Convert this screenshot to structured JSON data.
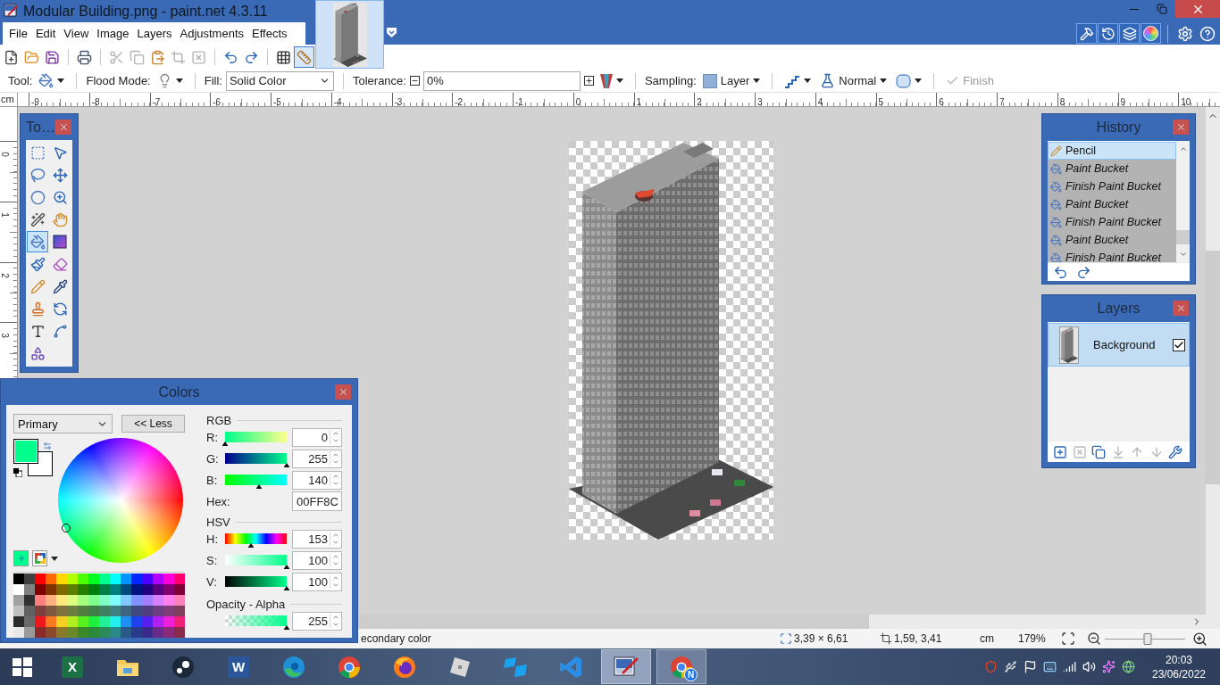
{
  "window": {
    "title": "Modular Building.png - paint.net 4.3.11",
    "menu": [
      "File",
      "Edit",
      "View",
      "Image",
      "Layers",
      "Adjustments",
      "Effects"
    ],
    "panel_toggles": [
      {
        "kind": "tools",
        "on": true
      },
      {
        "kind": "history",
        "on": true
      },
      {
        "kind": "layers",
        "on": true
      },
      {
        "kind": "colors",
        "on": true
      }
    ],
    "utility_buttons": [
      {
        "kind": "settings"
      },
      {
        "kind": "help"
      }
    ]
  },
  "toolbar": {
    "groups": [
      {
        "buttons": [
          {
            "kind": "new",
            "disabled": false,
            "on": false
          },
          {
            "kind": "open",
            "disabled": false,
            "on": false
          },
          {
            "kind": "save",
            "disabled": false,
            "on": false
          }
        ]
      },
      {
        "buttons": [
          {
            "kind": "print",
            "disabled": false,
            "on": false
          }
        ]
      },
      {
        "buttons": [
          {
            "kind": "cut",
            "disabled": true,
            "on": false
          },
          {
            "kind": "copy",
            "disabled": true,
            "on": false
          },
          {
            "kind": "paste",
            "disabled": false,
            "on": false
          },
          {
            "kind": "crop",
            "disabled": true,
            "on": false
          },
          {
            "kind": "deselect",
            "disabled": true,
            "on": false
          }
        ]
      },
      {
        "buttons": [
          {
            "kind": "undo",
            "disabled": false,
            "on": false
          },
          {
            "kind": "redo",
            "disabled": false,
            "on": false
          }
        ]
      },
      {
        "buttons": [
          {
            "kind": "grid",
            "disabled": false,
            "on": false
          },
          {
            "kind": "rulers",
            "disabled": false,
            "on": true
          }
        ]
      }
    ]
  },
  "options_bar": {
    "tool_label": "Tool:",
    "flood_mode_label": "Flood Mode:",
    "fill_label": "Fill:",
    "fill_value": "Solid Color",
    "tolerance_label": "Tolerance:",
    "tolerance_value": "0%",
    "sampling_label": "Sampling:",
    "sampling_value": "Layer",
    "blend_value": "Normal",
    "finish": {
      "label": "Finish",
      "disabled": true
    }
  },
  "ruler": {
    "unit": "cm",
    "horizontal": [
      "-9",
      "-8",
      "-7",
      "-6",
      "-5",
      "-4",
      "-3",
      "-2",
      "-1",
      "0",
      "1",
      "2",
      "3",
      "4",
      "5",
      "6",
      "7",
      "8",
      "9",
      "10"
    ],
    "vertical": [
      "0",
      "1",
      "2",
      "3"
    ]
  },
  "tools_window": {
    "title": "To…",
    "tools": [
      {
        "kind": "rect-select",
        "selected": false
      },
      {
        "kind": "move-pixels",
        "selected": false
      },
      {
        "kind": "lasso",
        "selected": false
      },
      {
        "kind": "move-selection",
        "selected": false
      },
      {
        "kind": "ellipse-select",
        "selected": false
      },
      {
        "kind": "zoom",
        "selected": false
      },
      {
        "kind": "magic-wand",
        "selected": false
      },
      {
        "kind": "pan",
        "selected": false
      },
      {
        "kind": "paint-bucket",
        "selected": true
      },
      {
        "kind": "gradient",
        "selected": false
      },
      {
        "kind": "paintbrush",
        "selected": false
      },
      {
        "kind": "eraser",
        "selected": false
      },
      {
        "kind": "pencil",
        "selected": false
      },
      {
        "kind": "color-picker",
        "selected": false
      },
      {
        "kind": "clone-stamp",
        "selected": false
      },
      {
        "kind": "recolor",
        "selected": false
      },
      {
        "kind": "text",
        "selected": false
      },
      {
        "kind": "line",
        "selected": false
      },
      {
        "kind": "shapes",
        "selected": false
      }
    ]
  },
  "colors_window": {
    "title": "Colors",
    "target": "Primary",
    "less_button": "<< Less",
    "swatches": [
      {
        "kind": "primary",
        "color": "#00ff8c"
      },
      {
        "kind": "secondary",
        "color": "#ffffff"
      }
    ],
    "rgb_heading": "RGB",
    "channels": [
      {
        "kind": "red",
        "label": "R:",
        "value": "0",
        "level": 0
      },
      {
        "kind": "green",
        "label": "G:",
        "value": "255",
        "level": 1
      },
      {
        "kind": "blue",
        "label": "B:",
        "value": "140",
        "level": 0.55
      }
    ],
    "hex_label": "Hex:",
    "hex_value": "00FF8C",
    "hsv_heading": "HSV",
    "hsv": [
      {
        "kind": "hue",
        "label": "H:",
        "value": "153",
        "level": 0.425
      },
      {
        "kind": "saturation",
        "label": "S:",
        "value": "100",
        "level": 1
      },
      {
        "kind": "value",
        "label": "V:",
        "value": "100",
        "level": 1
      }
    ],
    "alpha_heading": "Opacity - Alpha",
    "alpha": {
      "value": "255",
      "level": 1
    },
    "palette": [
      {
        "swatches": [
          {
            "color": "#000000"
          },
          {
            "color": "#404040"
          },
          {
            "color": "#ff0000"
          },
          {
            "color": "#ff6a00"
          },
          {
            "color": "#ffd800"
          },
          {
            "color": "#b6ff00"
          },
          {
            "color": "#4cff00"
          },
          {
            "color": "#00ff21"
          },
          {
            "color": "#00ff90"
          },
          {
            "color": "#00ffff"
          },
          {
            "color": "#0094ff"
          },
          {
            "color": "#0026ff"
          },
          {
            "color": "#4800ff"
          },
          {
            "color": "#b200ff"
          },
          {
            "color": "#ff00dc"
          },
          {
            "color": "#ff006e"
          }
        ]
      },
      {
        "swatches": [
          {
            "color": "#ffffff"
          },
          {
            "color": "#808080"
          },
          {
            "color": "#7f0000"
          },
          {
            "color": "#7f3300"
          },
          {
            "color": "#7f6a00"
          },
          {
            "color": "#5b7f00"
          },
          {
            "color": "#267f00"
          },
          {
            "color": "#007f0e"
          },
          {
            "color": "#007f46"
          },
          {
            "color": "#007f7f"
          },
          {
            "color": "#004a7f"
          },
          {
            "color": "#00137f"
          },
          {
            "color": "#21007f"
          },
          {
            "color": "#57007f"
          },
          {
            "color": "#7f006e"
          },
          {
            "color": "#7f0037"
          }
        ]
      },
      {
        "swatches": [
          {
            "color": "#a0a0a0"
          },
          {
            "color": "#303030"
          },
          {
            "color": "#ff7f7f"
          },
          {
            "color": "#ffb27f"
          },
          {
            "color": "#ffe97f"
          },
          {
            "color": "#daff7f"
          },
          {
            "color": "#a5ff7f"
          },
          {
            "color": "#7fff8e"
          },
          {
            "color": "#7fffc5"
          },
          {
            "color": "#7fffff"
          },
          {
            "color": "#7fc9ff"
          },
          {
            "color": "#7f92ff"
          },
          {
            "color": "#a17fff"
          },
          {
            "color": "#d67fff"
          },
          {
            "color": "#ff7fed"
          },
          {
            "color": "#ff7fb6"
          }
        ]
      },
      {
        "swatches": [
          {
            "color": "#c0c0c0"
          },
          {
            "color": "#606060"
          },
          {
            "color": "#7f3f3f"
          },
          {
            "color": "#7f593f"
          },
          {
            "color": "#7f743f"
          },
          {
            "color": "#6d7f3f"
          },
          {
            "color": "#527f3f"
          },
          {
            "color": "#3f7f47"
          },
          {
            "color": "#3f7f62"
          },
          {
            "color": "#3f7f7f"
          },
          {
            "color": "#3f647f"
          },
          {
            "color": "#3f497f"
          },
          {
            "color": "#503f7f"
          },
          {
            "color": "#6b3f7f"
          },
          {
            "color": "#7f3f76"
          },
          {
            "color": "#7f3f5b"
          }
        ]
      },
      {
        "swatches": [
          {
            "color": "#2a2a2a"
          },
          {
            "color": "#6a6a6a"
          },
          {
            "color": "#f01818"
          },
          {
            "color": "#f57a20"
          },
          {
            "color": "#f5d020"
          },
          {
            "color": "#b0f020"
          },
          {
            "color": "#58f020"
          },
          {
            "color": "#20f040"
          },
          {
            "color": "#20f09a"
          },
          {
            "color": "#20f0f0"
          },
          {
            "color": "#2090f0"
          },
          {
            "color": "#2040f0"
          },
          {
            "color": "#5820f0"
          },
          {
            "color": "#b020f0"
          },
          {
            "color": "#f020d8"
          },
          {
            "color": "#f02078"
          }
        ]
      },
      {
        "swatches": [
          {
            "color": "#e8e8e8"
          },
          {
            "color": "#9a9a9a"
          },
          {
            "color": "#8a2a2a"
          },
          {
            "color": "#8a4a2a"
          },
          {
            "color": "#8a7a2a"
          },
          {
            "color": "#6a8a2a"
          },
          {
            "color": "#3a8a2a"
          },
          {
            "color": "#2a8a3a"
          },
          {
            "color": "#2a8a5a"
          },
          {
            "color": "#2a8a8a"
          },
          {
            "color": "#2a5a8a"
          },
          {
            "color": "#2a3a8a"
          },
          {
            "color": "#3a2a8a"
          },
          {
            "color": "#6a2a8a"
          },
          {
            "color": "#8a2a7a"
          },
          {
            "color": "#8a2a4a"
          }
        ]
      }
    ]
  },
  "history_window": {
    "title": "History",
    "items": [
      {
        "kind": "pencil",
        "label": "Pencil",
        "selected": true,
        "undone": false
      },
      {
        "kind": "bucket",
        "label": "Paint Bucket",
        "selected": false,
        "undone": true
      },
      {
        "kind": "bucket",
        "label": "Finish Paint Bucket",
        "selected": false,
        "undone": true
      },
      {
        "kind": "bucket",
        "label": "Paint Bucket",
        "selected": false,
        "undone": true
      },
      {
        "kind": "bucket",
        "label": "Finish Paint Bucket",
        "selected": false,
        "undone": true
      },
      {
        "kind": "bucket",
        "label": "Paint Bucket",
        "selected": false,
        "undone": true
      },
      {
        "kind": "bucket",
        "label": "Finish Paint Bucket",
        "selected": false,
        "undone": true
      }
    ],
    "actions": [
      {
        "kind": "undo"
      },
      {
        "kind": "redo"
      }
    ]
  },
  "layers_window": {
    "title": "Layers",
    "layers": [
      {
        "name": "Background",
        "selected": true,
        "visible": true
      }
    ],
    "actions": [
      {
        "kind": "add",
        "disabled": false
      },
      {
        "kind": "delete",
        "disabled": true
      },
      {
        "kind": "duplicate",
        "disabled": false
      },
      {
        "kind": "merge",
        "disabled": true
      },
      {
        "kind": "up",
        "disabled": true
      },
      {
        "kind": "down",
        "disabled": true
      },
      {
        "kind": "properties",
        "disabled": false
      }
    ]
  },
  "status_bar": {
    "hint": "econdary color",
    "selection_size": "3,39 × 6,61",
    "cursor_position": "1,59, 3,41",
    "unit": "cm",
    "zoom": "179%",
    "zoom_slider": {
      "level": 0.53
    }
  },
  "taskbar": {
    "apps": [
      {
        "kind": "excel",
        "glyph": "X",
        "open": false,
        "active": false
      },
      {
        "kind": "explorer",
        "open": false,
        "active": false
      },
      {
        "kind": "steam",
        "open": false,
        "active": false
      },
      {
        "kind": "word",
        "glyph": "W",
        "open": false,
        "active": false
      },
      {
        "kind": "edge",
        "open": false,
        "active": false
      },
      {
        "kind": "chrome",
        "open": false,
        "active": false
      },
      {
        "kind": "firefox",
        "open": false,
        "active": false
      },
      {
        "kind": "roblox",
        "open": false,
        "active": false
      },
      {
        "kind": "studio",
        "open": false,
        "active": false
      },
      {
        "kind": "code",
        "open": false,
        "active": false
      },
      {
        "kind": "paint",
        "open": true,
        "active": true
      },
      {
        "kind": "chrome",
        "badge": "N",
        "open": true,
        "active": false
      }
    ],
    "tray": [
      {
        "kind": "alert"
      },
      {
        "kind": "usb"
      },
      {
        "kind": "flag"
      },
      {
        "kind": "keyboard"
      },
      {
        "kind": "signal"
      },
      {
        "kind": "volume"
      },
      {
        "kind": "app"
      },
      {
        "kind": "network"
      }
    ],
    "time": "20:03",
    "date": "23/06/2022"
  }
}
